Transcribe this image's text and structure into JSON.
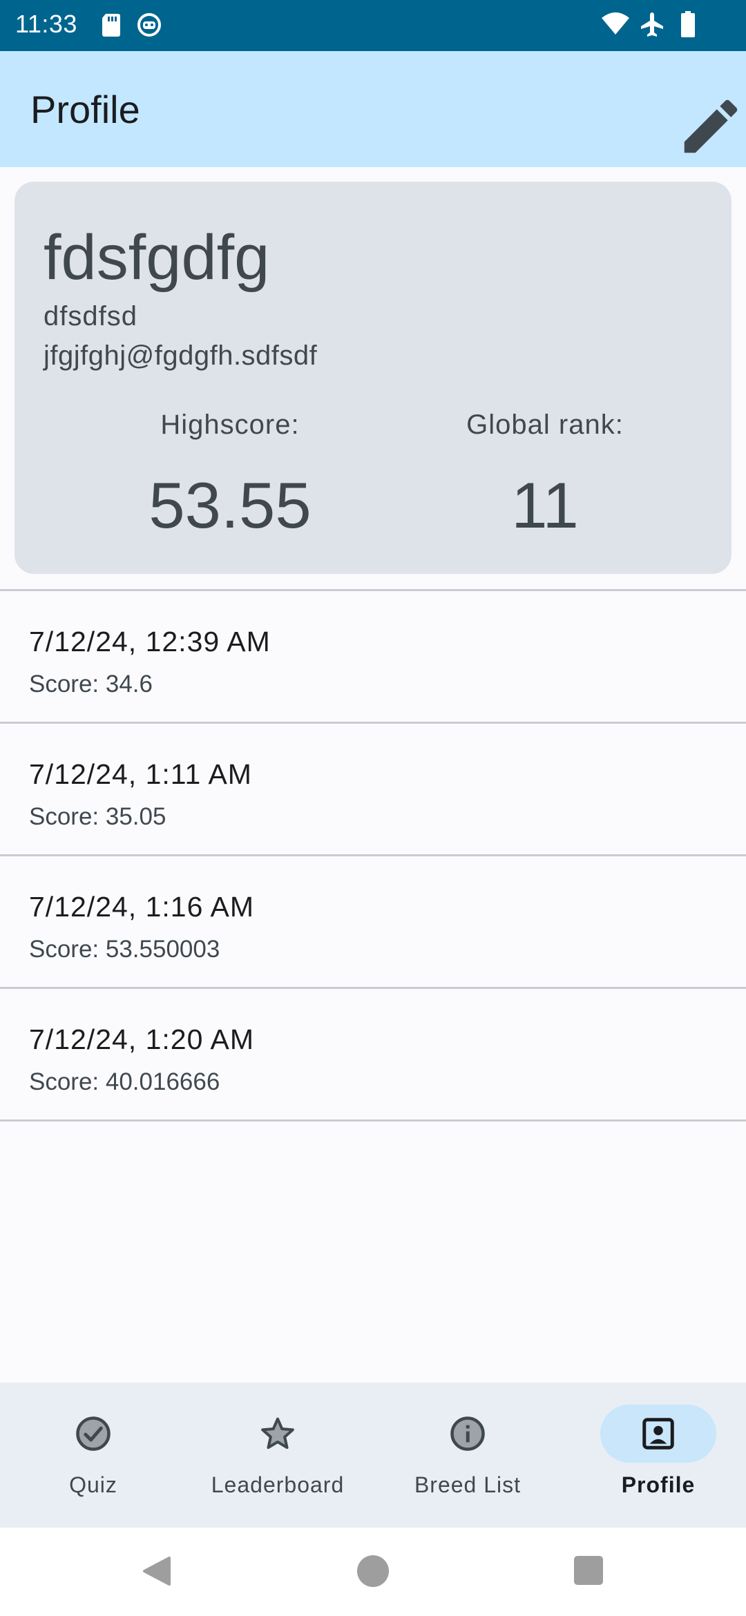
{
  "status_bar": {
    "time": "11:33",
    "left_icons": [
      "sd-card-icon",
      "android-debug-icon"
    ],
    "right_icons": [
      "wifi-icon",
      "airplane-mode-icon",
      "battery-icon"
    ]
  },
  "app_bar": {
    "title": "Profile",
    "action_icon": "edit-icon"
  },
  "profile": {
    "name": "fdsfgdfg",
    "nickname": "dfsdfsd",
    "email": "jfgjfghj@fgdgfh.sdfsdf",
    "highscore_label": "Highscore:",
    "highscore_value": "53.55",
    "rank_label": "Global rank:",
    "rank_value": "11"
  },
  "history": [
    {
      "date": "7/12/24, 12:39 AM",
      "score": "Score: 34.6"
    },
    {
      "date": "7/12/24, 1:11 AM",
      "score": "Score: 35.05"
    },
    {
      "date": "7/12/24, 1:16 AM",
      "score": "Score: 53.550003"
    },
    {
      "date": "7/12/24, 1:20 AM",
      "score": "Score: 40.016666"
    }
  ],
  "bottom_nav": [
    {
      "label": "Quiz",
      "icon": "check-circle-icon",
      "active": false
    },
    {
      "label": "Leaderboard",
      "icon": "star-icon",
      "active": false
    },
    {
      "label": "Breed List",
      "icon": "info-icon",
      "active": false
    },
    {
      "label": "Profile",
      "icon": "account-box-icon",
      "active": true
    }
  ],
  "colors": {
    "status_bar": "#00658E",
    "app_bar": "#C3E7FF",
    "card": "#DEE3EA",
    "nav_bar": "#E8EEF4",
    "active_indicator": "#C9E6FB"
  }
}
